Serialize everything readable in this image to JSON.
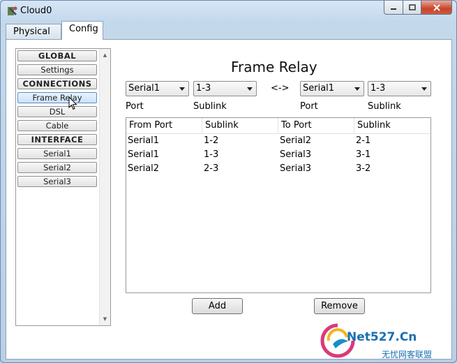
{
  "window": {
    "title": "Cloud0"
  },
  "tabs": [
    {
      "label": "Physical"
    },
    {
      "label": "Config"
    }
  ],
  "sidebar": {
    "items": [
      {
        "label": "GLOBAL"
      },
      {
        "label": "Settings"
      },
      {
        "label": "CONNECTIONS"
      },
      {
        "label": "Frame Relay"
      },
      {
        "label": "DSL"
      },
      {
        "label": "Cable"
      },
      {
        "label": "INTERFACE"
      },
      {
        "label": "Serial1"
      },
      {
        "label": "Serial2"
      },
      {
        "label": "Serial3"
      }
    ]
  },
  "main": {
    "heading": "Frame Relay",
    "left_port_value": "Serial1",
    "left_sublink_value": "1-3",
    "right_port_value": "Serial1",
    "right_sublink_value": "1-3",
    "connector": "<->",
    "port_label": "Port",
    "sublink_label": "Sublink",
    "columns": [
      "From Port",
      "Sublink",
      "To Port",
      "Sublink"
    ],
    "rows": [
      [
        "Serial1",
        "1-2",
        "Serial2",
        "2-1"
      ],
      [
        "Serial1",
        "1-3",
        "Serial3",
        "3-1"
      ],
      [
        "Serial2",
        "2-3",
        "Serial3",
        "3-2"
      ]
    ],
    "add_label": "Add",
    "remove_label": "Remove"
  },
  "watermark": {
    "text": "Net527.Cn",
    "subtitle": "无忧网客联盟"
  }
}
